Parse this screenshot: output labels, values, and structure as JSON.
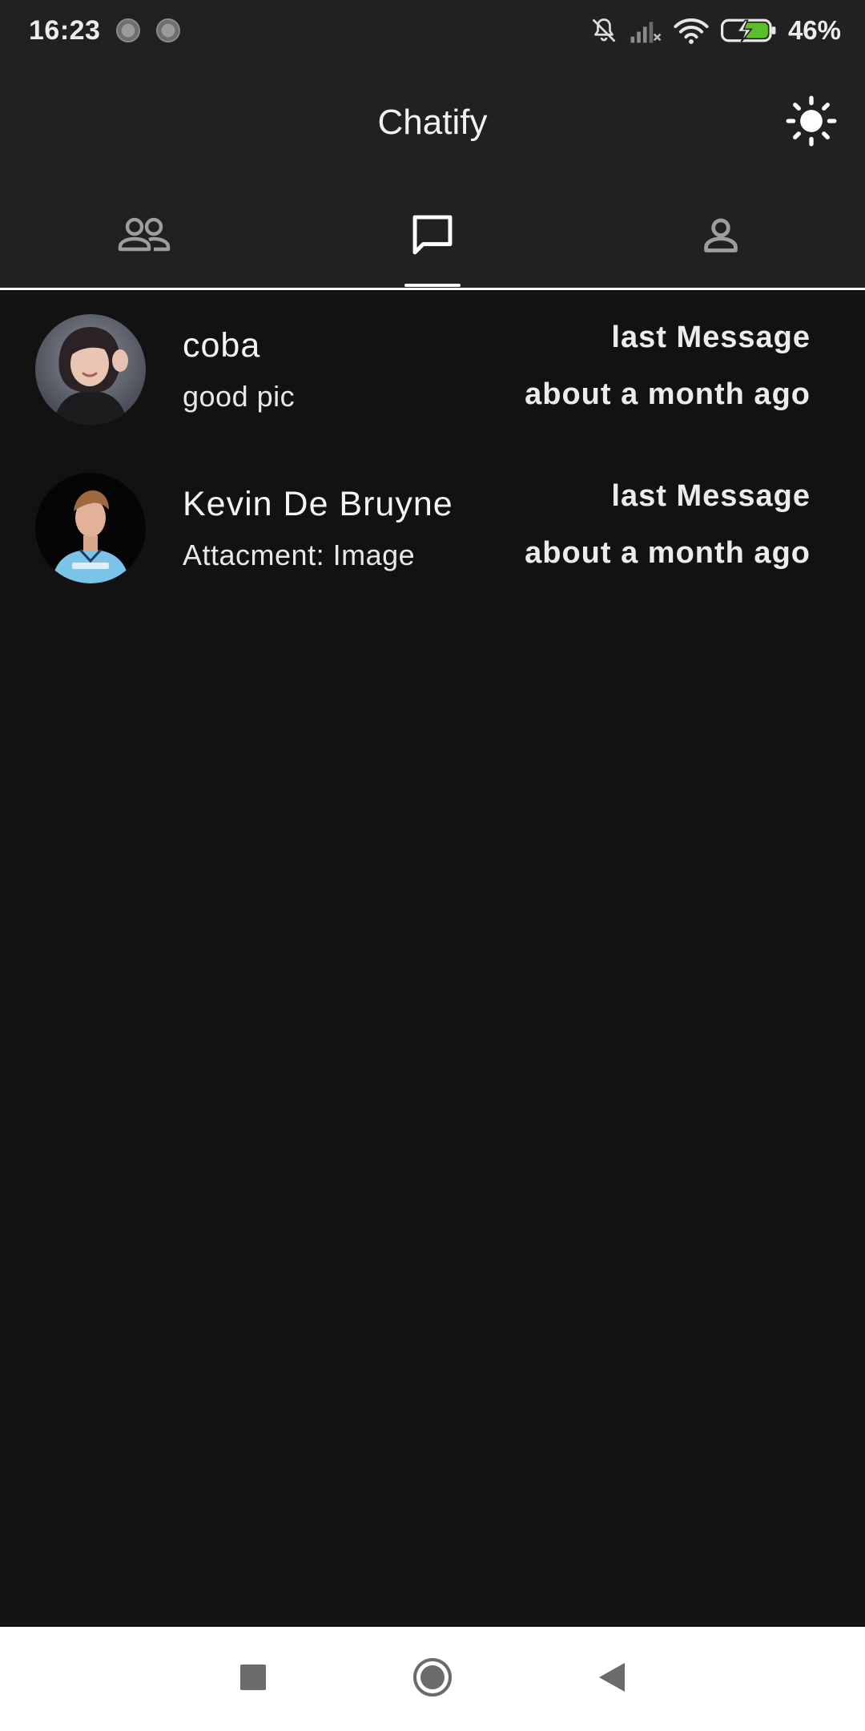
{
  "status_bar": {
    "time": "16:23",
    "battery_percent": "46%",
    "icons": [
      "notifications-off-icon",
      "signal-icon",
      "wifi-icon",
      "battery-charging-icon"
    ]
  },
  "app_bar": {
    "title": "Chatify",
    "theme_toggle_icon": "sun-icon"
  },
  "tabs": [
    {
      "icon": "people-icon",
      "active": false
    },
    {
      "icon": "chat-bubble-icon",
      "active": true
    },
    {
      "icon": "person-icon",
      "active": false
    }
  ],
  "chats": [
    {
      "name": "coba",
      "preview": "good pic",
      "meta_label": "last Message",
      "time": "about a month ago"
    },
    {
      "name": "Kevin De Bruyne",
      "preview": "Attacment: Image",
      "meta_label": "last Message",
      "time": "about a month ago"
    }
  ],
  "nav_bar": {
    "buttons": [
      "recents-icon",
      "home-icon",
      "back-icon"
    ]
  },
  "colors": {
    "background": "#121212",
    "app_bar": "#212121",
    "accent": "#ffffff",
    "battery_fill": "#5bbf2a",
    "nav_bar": "#ffffff"
  }
}
